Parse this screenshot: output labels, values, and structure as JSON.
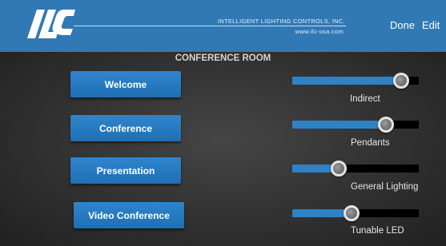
{
  "header": {
    "logo_text": "ILC",
    "company_name": "INTELLIGENT LIGHTING CONTROLS, INC.",
    "company_url": "www.ilc-usa.com",
    "done_label": "Done",
    "edit_label": "Edit",
    "bar_color": "#3179b5"
  },
  "room": {
    "title": "CONFERENCE ROOM"
  },
  "scenes": [
    {
      "label": "Welcome"
    },
    {
      "label": "Conference"
    },
    {
      "label": "Presentation"
    },
    {
      "label": "Video Conference"
    }
  ],
  "sliders": [
    {
      "label": "Indirect",
      "level": 0.86
    },
    {
      "label": "Pendants",
      "level": 0.74
    },
    {
      "label": "General Lighting",
      "level": 0.37
    },
    {
      "label": "Tunable LED",
      "level": 0.47
    }
  ],
  "colors": {
    "accent": "#2f82c5",
    "button": "#2677bf",
    "track": "#000000"
  }
}
